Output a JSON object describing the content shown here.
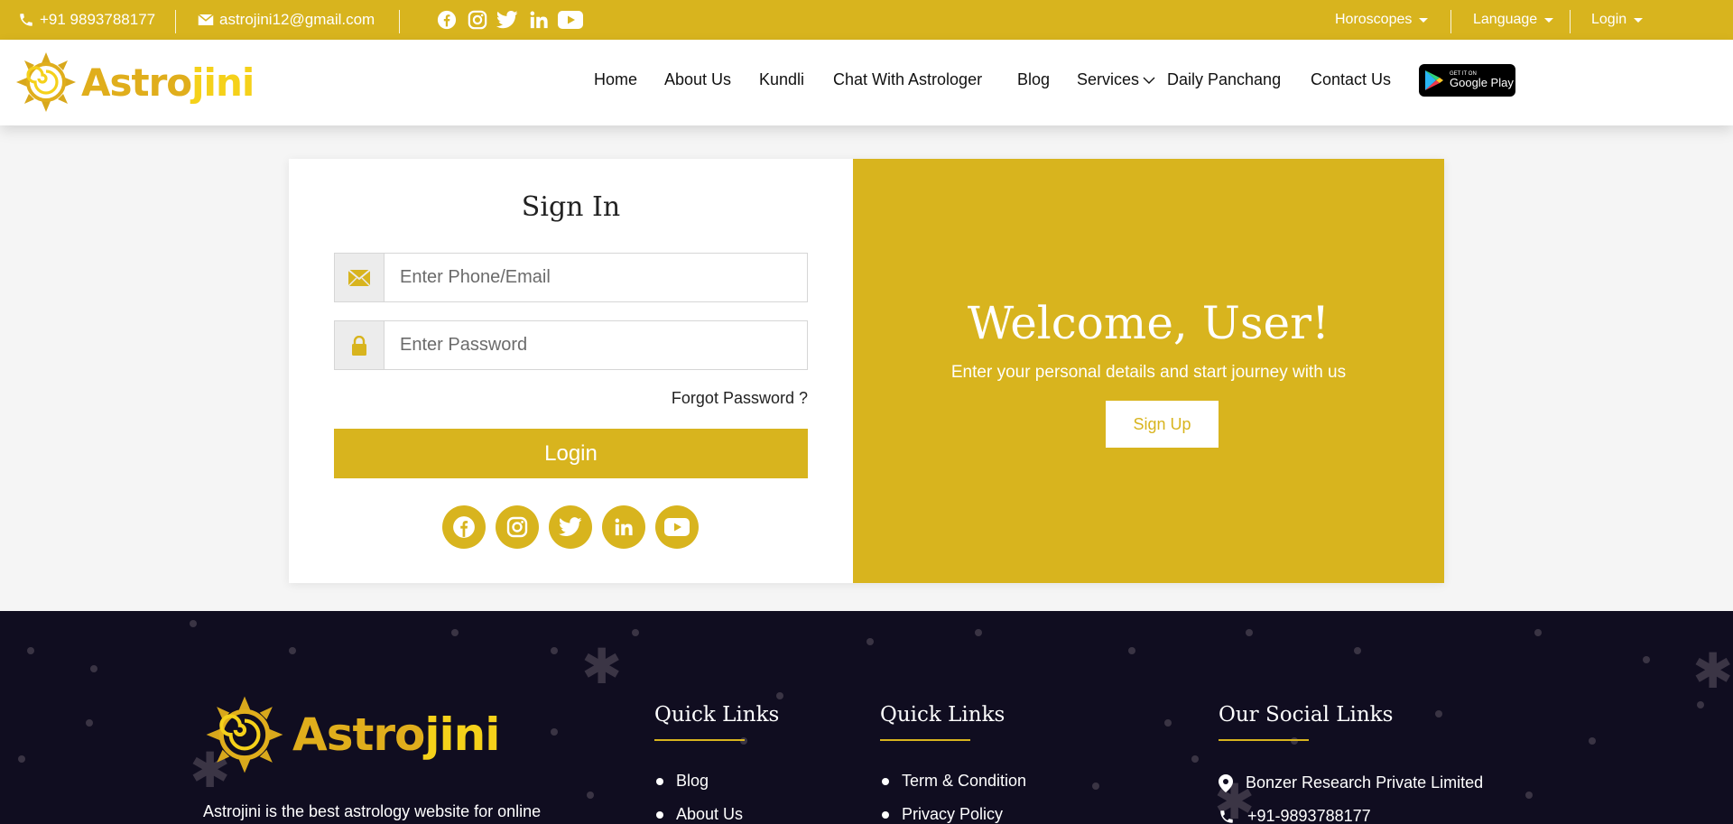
{
  "topbar": {
    "phone": "+91 9893788177",
    "email": "astrojini12@gmail.com",
    "social_icons": [
      "facebook-icon",
      "instagram-icon",
      "twitter-icon",
      "linkedin-icon",
      "youtube-icon"
    ],
    "dropdowns": [
      "Horoscopes",
      "Language",
      "Login"
    ]
  },
  "header": {
    "logo_part1": "Astro",
    "logo_part2": "jini",
    "nav": [
      "Home",
      "About Us",
      "Kundli",
      "Chat With Astrologer",
      "Blog",
      "Services",
      "Daily Panchang",
      "Contact Us"
    ],
    "store_badge_small": "GET IT ON",
    "store_badge_big": "Google Play"
  },
  "signin": {
    "title": "Sign In",
    "email_placeholder": "Enter Phone/Email",
    "password_placeholder": "Enter Password",
    "forgot": "Forgot Password ?",
    "login_button": "Login",
    "social_icons": [
      "facebook-icon",
      "instagram-icon",
      "twitter-icon",
      "linkedin-icon",
      "youtube-icon"
    ]
  },
  "welcome": {
    "title": "Welcome, User!",
    "subtitle": "Enter your personal details and start journey with us",
    "signup_button": "Sign Up"
  },
  "footer": {
    "logo_part1": "Astro",
    "logo_part2": "jini",
    "description": "Astrojini is the best astrology website for online",
    "quick_links_1": {
      "title": "Quick Links",
      "items": [
        "Blog",
        "About Us"
      ]
    },
    "quick_links_2": {
      "title": "Quick Links",
      "items": [
        "Term & Condition",
        "Privacy Policy"
      ]
    },
    "social": {
      "title": "Our Social Links",
      "company": "Bonzer Research Private Limited",
      "phone": "+91-9893788177"
    }
  },
  "colors": {
    "brand_gold": "#d8b41e",
    "footer_bg": "#100d20"
  }
}
